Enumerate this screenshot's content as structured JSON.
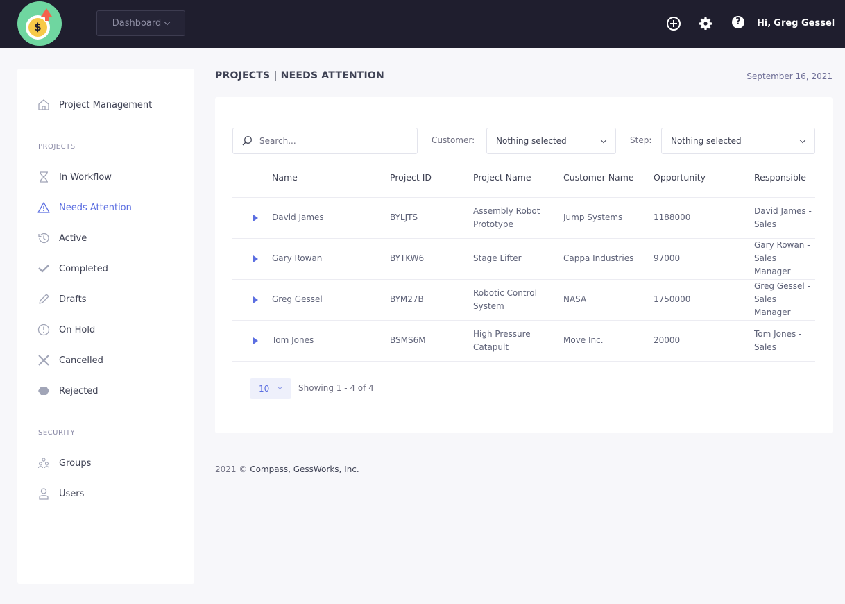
{
  "topbar": {
    "logo_symbol": "$",
    "dashboard_label": "Dashboard",
    "greeting_hi": "Hi,",
    "user_name": "Greg Gessel",
    "help_symbol": "?",
    "icons": [
      "add-circle-icon",
      "gear-icon",
      "help-icon"
    ],
    "colors": {
      "bar": "#1f1e2e",
      "logo_bg": "#6fd6a0",
      "coin": "#f7c948",
      "arrow": "#f4624b"
    }
  },
  "sidebar": {
    "home": {
      "label": "Project Management",
      "icon": "home-icon"
    },
    "projects_label": "PROJECTS",
    "project_items": [
      {
        "label": "In Workflow",
        "icon": "hourglass-icon"
      },
      {
        "label": "Needs Attention",
        "icon": "warning-icon",
        "active": true
      },
      {
        "label": "Active",
        "icon": "history-icon"
      },
      {
        "label": "Completed",
        "icon": "check-icon"
      },
      {
        "label": "Drafts",
        "icon": "pencil-icon"
      },
      {
        "label": "On Hold",
        "icon": "exclamation-circle-icon"
      },
      {
        "label": "Cancelled",
        "icon": "x-icon"
      },
      {
        "label": "Rejected",
        "icon": "hexagon-icon"
      }
    ],
    "security_label": "SECURITY",
    "security_items": [
      {
        "label": "Groups",
        "icon": "groups-icon"
      },
      {
        "label": "Users",
        "icon": "user-icon"
      }
    ],
    "active_color": "#5b6ee1"
  },
  "page": {
    "title": "PROJECTS | NEEDS ATTENTION",
    "date": "September 16, 2021"
  },
  "filters": {
    "search_placeholder": "Search...",
    "customer_label": "Customer:",
    "customer_value": "Nothing selected",
    "step_label": "Step:",
    "step_value": "Nothing selected"
  },
  "table": {
    "columns": [
      "Name",
      "Project ID",
      "Project Name",
      "Customer Name",
      "Opportunity",
      "Responsible"
    ],
    "rows": [
      {
        "name": "David James",
        "project_id": "BYLJTS",
        "project_name": "Assembly Robot Prototype",
        "customer": "Jump Systems",
        "opportunity": "1188000",
        "responsible": "David James - Sales"
      },
      {
        "name": "Gary Rowan",
        "project_id": "BYTKW6",
        "project_name": "Stage Lifter",
        "customer": "Cappa Industries",
        "opportunity": "97000",
        "responsible": "Gary Rowan - Sales Manager"
      },
      {
        "name": "Greg Gessel",
        "project_id": "BYM27B",
        "project_name": "Robotic Control System",
        "customer": "NASA",
        "opportunity": "1750000",
        "responsible": "Greg Gessel - Sales Manager"
      },
      {
        "name": "Tom Jones",
        "project_id": "BSMS6M",
        "project_name": "High Pressure Catapult",
        "customer": "Move Inc.",
        "opportunity": "20000",
        "responsible": "Tom Jones - Sales"
      }
    ]
  },
  "pagination": {
    "page_size": "10",
    "showing": "Showing 1 - 4 of 4"
  },
  "footer": {
    "year": "2021 ©",
    "company": "Compass, GessWorks, Inc."
  }
}
